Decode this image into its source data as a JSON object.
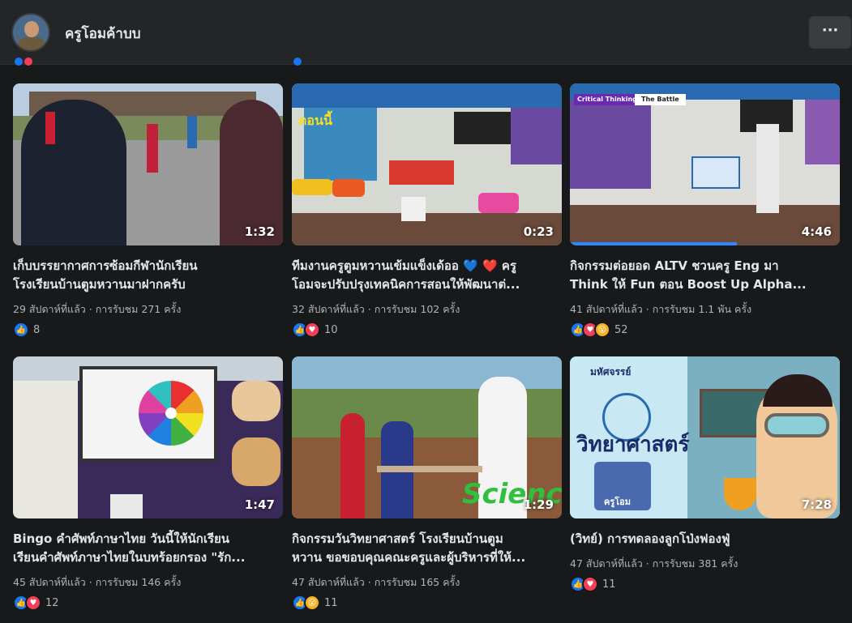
{
  "header": {
    "page_name": "ครูโอมค้าบบ",
    "more_label": "···"
  },
  "colors": {
    "background": "#18191a",
    "header": "#242526",
    "like": "#1877f2",
    "love": "#f33e58",
    "wow": "#f7b125",
    "progress": "#2d88ff"
  },
  "videos": [
    {
      "duration": "1:32",
      "title_line1": "เก็บบรรยากาศการซ้อมกีฬานักเรียน",
      "title_line2": "โรงเรียนบ้านตูมหวานมาฝากครับ",
      "meta": "29 สัปดาห์ที่แล้ว · การรับชม 271 ครั้ง",
      "reactions": [
        "like-icon"
      ],
      "reaction_count": "8"
    },
    {
      "duration": "0:23",
      "title_line1": "ทีมงานครูตูมหวานเข้มแข็งเด้ออ 💙 ❤️ ครู",
      "title_line2": "โอมจะปรับปรุงเทคนิคการสอนให้พัฒนาต่...",
      "meta": "32 สัปดาห์ที่แล้ว · การรับชม 102 ครั้ง",
      "reactions": [
        "like-icon",
        "love-icon"
      ],
      "reaction_count": "10"
    },
    {
      "duration": "4:46",
      "title_line1": "กิจกรรมต่อยอด ALTV ชวนครู Eng มา",
      "title_line2": "Think ให้ Fun ตอน Boost Up Alpha...",
      "meta": "41 สัปดาห์ที่แล้ว · การรับชม 1.1 พัน ครั้ง",
      "reactions": [
        "like-icon",
        "love-icon",
        "wow-icon"
      ],
      "reaction_count": "52",
      "progress": 0.62,
      "thumb_tags": [
        "Critical Thinking",
        "The Battle"
      ]
    },
    {
      "duration": "1:47",
      "title_line1": "Bingo คำศัพท์ภาษาไทย วันนี้ให้นักเรียน",
      "title_line2": "เรียนคำศัพท์ภาษาไทยในบทร้อยกรอง \"รัก...",
      "meta": "45 สัปดาห์ที่แล้ว · การรับชม 146 ครั้ง",
      "reactions": [
        "like-icon",
        "love-icon"
      ],
      "reaction_count": "12"
    },
    {
      "duration": "1:29",
      "title_line1": "กิจกรรมวันวิทยาศาสตร์ โรงเรียนบ้านตูม",
      "title_line2": "หวาน ขอขอบคุณคณะครูและผู้บริหารที่ให้...",
      "meta": "47 สัปดาห์ที่แล้ว · การรับชม 165 ครั้ง",
      "reactions": [
        "like-icon",
        "wow-icon"
      ],
      "reaction_count": "11",
      "thumb_text": "Science"
    },
    {
      "duration": "7:28",
      "title_line1": "(วิทย์) การทดลองลูกโป่งฟองฟู่",
      "title_line2": "",
      "meta": "47 สัปดาห์ที่แล้ว · การรับชม 381 ครั้ง",
      "reactions": [
        "like-icon",
        "love-icon"
      ],
      "reaction_count": "11",
      "thumb_title": "วิทยาศาสตร์",
      "thumb_small": "มหัศจรรย์",
      "thumb_caption": "ครูโอม"
    }
  ]
}
